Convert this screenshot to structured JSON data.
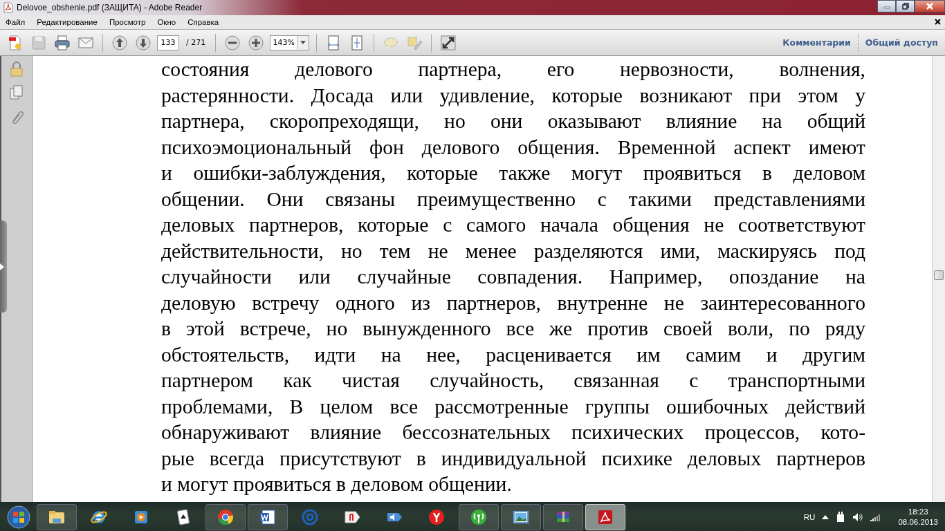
{
  "window": {
    "title": "Delovoe_obshenie.pdf (ЗАЩИТА) - Adobe Reader"
  },
  "menu": [
    "Файл",
    "Редактирование",
    "Просмотр",
    "Окно",
    "Справка"
  ],
  "toolbar": {
    "page": "133",
    "page_total": "/ 271",
    "zoom": "143%",
    "links": [
      "Комментарии",
      "Общий доступ"
    ]
  },
  "document": {
    "lines": [
      "состояния делового партнера, его нервозности, волнения,",
      "растерянности. Досада или удивление, которые возникают при этом у",
      "партнера, скоропреходящи, но они оказывают влияние на общий",
      "психоэмоциональный фон делового общения. Временной аспект имеют",
      "и ошибки-заблуждения, которые также могут проявиться в деловом",
      "общении. Они связаны преимущественно с такими представлениями",
      "деловых партнеров, которые с самого начала общения не соответствуют",
      "действительности, но тем не менее разделяются ими, маскируясь под",
      "случайности или случайные совпадения. Например, опоздание на",
      "деловую встречу одного из партнеров, внутренне не заинтересованного",
      "в этой встрече, но вынужденного все же против своей воли, по ряду",
      "обстоятельств, идти на нее, расценивается им самим и другим",
      "партнером как чистая случайность, связанная с транспортными",
      "проблемами, В целом все рассмотренные группы ошибочных действий",
      "обнаруживают влияние бессознательных психических процессов, кото-",
      "рые всегда присутствуют в индивидуальной психике деловых партнеров",
      "и могут проявиться в деловом общении."
    ]
  },
  "taskbar": {
    "apps": [
      {
        "kind": "folder",
        "open": true,
        "selected": false
      },
      {
        "kind": "browser-e",
        "open": false,
        "selected": false
      },
      {
        "kind": "player",
        "open": false,
        "selected": false
      },
      {
        "kind": "cards",
        "open": false,
        "selected": false
      },
      {
        "kind": "chrome",
        "open": true,
        "selected": false
      },
      {
        "kind": "word",
        "open": true,
        "selected": false
      },
      {
        "kind": "at",
        "open": false,
        "selected": false
      },
      {
        "kind": "ya",
        "open": false,
        "selected": false
      },
      {
        "kind": "speaker",
        "open": false,
        "selected": false
      },
      {
        "kind": "yabrowser",
        "open": false,
        "selected": false
      },
      {
        "kind": "wifi",
        "open": true,
        "selected": false
      },
      {
        "kind": "photo",
        "open": true,
        "selected": false
      },
      {
        "kind": "archive",
        "open": true,
        "selected": false
      },
      {
        "kind": "pdf",
        "open": true,
        "selected": true
      }
    ],
    "language": "RU",
    "time": "18:23",
    "date": "08.06.2013"
  }
}
